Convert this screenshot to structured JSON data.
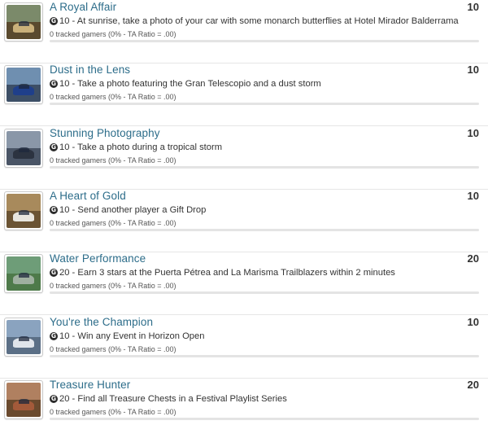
{
  "achievements": [
    {
      "title": "A Royal Affair",
      "points": "10",
      "description": "10 - At sunrise, take a photo of your car with some monarch butterflies at Hotel Mirador Balderrama",
      "tracked": "0 tracked gamers (0% - TA Ratio = .00)",
      "progress": 0,
      "thumb": {
        "sky": "#7b8a6a",
        "ground": "#5a4a2e",
        "car": "#c9b07a"
      }
    },
    {
      "title": "Dust in the Lens",
      "points": "10",
      "description": "10 - Take a photo featuring the Gran Telescopio and a dust storm",
      "tracked": "0 tracked gamers (0% - TA Ratio = .00)",
      "progress": 0,
      "thumb": {
        "sky": "#6f8fb0",
        "ground": "#3d4f66",
        "car": "#1f3f8a"
      }
    },
    {
      "title": "Stunning Photography",
      "points": "10",
      "description": "10 - Take a photo during a tropical storm",
      "tracked": "0 tracked gamers (0% - TA Ratio = .00)",
      "progress": 0,
      "thumb": {
        "sky": "#8a97a8",
        "ground": "#4a5566",
        "car": "#2c3340"
      }
    },
    {
      "title": "A Heart of Gold",
      "points": "10",
      "description": "10 - Send another player a Gift Drop",
      "tracked": "0 tracked gamers (0% - TA Ratio = .00)",
      "progress": 0,
      "thumb": {
        "sky": "#a88a5c",
        "ground": "#6b5434",
        "car": "#e8e6df"
      }
    },
    {
      "title": "Water Performance",
      "points": "20",
      "description": "20 - Earn 3 stars at the Puerta Pétrea and La Marisma Trailblazers within 2 minutes",
      "tracked": "0 tracked gamers (0% - TA Ratio = .00)",
      "progress": 0,
      "thumb": {
        "sky": "#6e9d78",
        "ground": "#4e7a4a",
        "car": "#9fb0a0"
      }
    },
    {
      "title": "You're the Champion",
      "points": "10",
      "description": "10 - Win any Event in Horizon Open",
      "tracked": "0 tracked gamers (0% - TA Ratio = .00)",
      "progress": 0,
      "thumb": {
        "sky": "#8aa3bf",
        "ground": "#5b6f86",
        "car": "#dfe4ea"
      }
    },
    {
      "title": "Treasure Hunter",
      "points": "20",
      "description": "20 - Find all Treasure Chests in a Festival Playlist Series",
      "tracked": "0 tracked gamers (0% - TA Ratio = .00)",
      "progress": 0,
      "thumb": {
        "sky": "#b08060",
        "ground": "#6a4a2e",
        "car": "#a35a3a"
      }
    }
  ],
  "icons": {
    "gamerscore": "G"
  }
}
